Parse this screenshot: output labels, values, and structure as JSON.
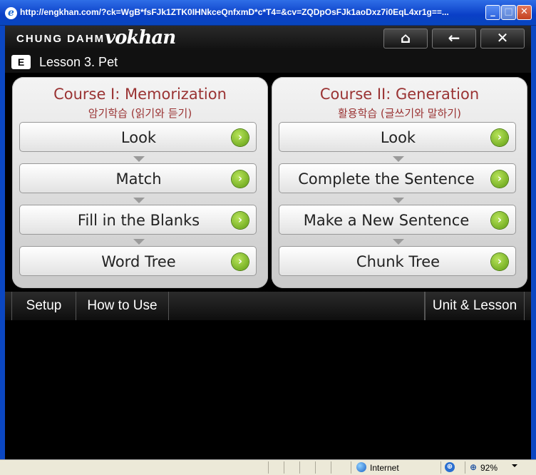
{
  "window": {
    "title": "http://engkhan.com/?ck=WgB*fsFJk1ZTK0IHNkceQnfxmD*c*T4=&cv=ZQDpOsFJk1aoDxz7i0EqL4xr1g==...",
    "minimize_glyph": "_",
    "maximize_glyph": "□",
    "close_glyph": "✕"
  },
  "header": {
    "brand": "CHUNG DAHM",
    "logo_text": "vokhan",
    "home_glyph": "⌂",
    "back_glyph": "←",
    "close_glyph": "✕"
  },
  "lesson": {
    "badge": "E",
    "title": "Lesson 3. Pet"
  },
  "courses": [
    {
      "title": "Course I: Memorization",
      "subtitle": "암기학습 (읽기와 듣기)",
      "steps": [
        "Look",
        "Match",
        "Fill in the Blanks",
        "Word Tree"
      ]
    },
    {
      "title": "Course II: Generation",
      "subtitle": "활용학습 (글쓰기와 말하기)",
      "steps": [
        "Look",
        "Complete the Sentence",
        "Make a New Sentence",
        "Chunk Tree"
      ]
    }
  ],
  "go_glyph": "›",
  "menu": {
    "setup": "Setup",
    "how_to_use": "How to Use",
    "unit_lesson": "Unit & Lesson"
  },
  "status": {
    "zone": "Internet",
    "zoom": "92%"
  }
}
